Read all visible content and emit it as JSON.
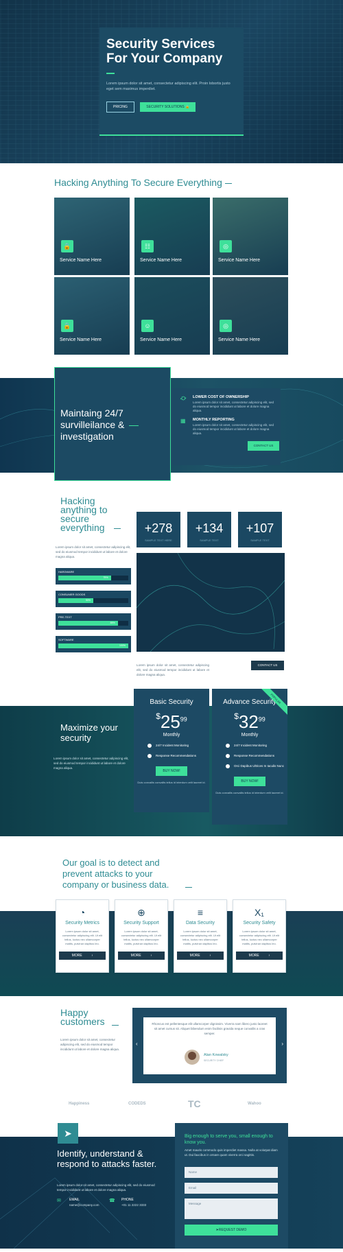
{
  "hero": {
    "title": "Security Services For Your Company",
    "text": "Lorem ipsum dolor sit amet, consectetur adipiscing elit. Proin lobortis justo eget sem maximus imperdiet.",
    "btn1": "PRICING",
    "btn2": "SECURITY SOLUTIONS"
  },
  "services": {
    "title": "Hacking Anything To Secure Everything",
    "items": [
      {
        "label": "Service Name Here",
        "icon": "lock-icon"
      },
      {
        "label": "Service Name Here",
        "icon": "document-icon"
      },
      {
        "label": "Service Name Here",
        "icon": "eye-slash-icon"
      },
      {
        "label": "Service Name Here",
        "icon": "lock-icon"
      },
      {
        "label": "Service Name Here",
        "icon": "smile-icon"
      },
      {
        "label": "Service Name Here",
        "icon": "eye-slash-icon"
      }
    ]
  },
  "surveillance": {
    "title": "Maintaing 24/7 survilleilance & investigation",
    "item1_title": "LOWER COST OF OWNERSHIP",
    "item1_text": "Lorem ipsum dolor sit amet, consectetur adipiscing elit, sed do eiusmod tempor incididunt ut labore et dolore magna aliqua.",
    "item2_title": "MONTHLY REPORTING",
    "item2_text": "Lorem ipsum dolor sit amet, consectetur adipiscing elit, sed do eiusmod tempor incididunt ut labore et dolore magna aliqua.",
    "btn": "CONTACT US"
  },
  "hacking": {
    "title": "Hacking anything to secure everything",
    "text": "Lorem ipsum dolor sit amet, consectetur adipiscing elit, sed do eiusmod tempor incididunt ut labore et dolore magna aliqua.",
    "stats": [
      {
        "value": "+278",
        "label": "SAMPLE TEXT HERE"
      },
      {
        "value": "+134",
        "label": "SAMPLE TEXT"
      },
      {
        "value": "+107",
        "label": "SAMPLE TEXT"
      }
    ],
    "bars": [
      {
        "label": "HARDWARE",
        "pct": "75%",
        "value": 0.75
      },
      {
        "label": "CONSUMER GOODS",
        "pct": "50%",
        "value": 0.5
      },
      {
        "label": "PRE-TEXT",
        "pct": "85%",
        "value": 0.85
      },
      {
        "label": "SOFTWARE",
        "pct": "100%",
        "value": 1.0
      }
    ],
    "text2": "Lorem ipsum dolor sit amet, consectetur adipiscing elit, sed do eiusmod tempor incididunt ut labore et dolore magna aliqua.",
    "btn": "CONTACT US"
  },
  "pricing": {
    "title": "Maximize your security",
    "text": "Lorem ipsum dolor sit amet, consectetur adipiscing elit, sed do eiusmod tempor incididunt ut labore et dolore magna aliqua.",
    "plans": [
      {
        "name": "Basic Security",
        "cur": "$",
        "amount": "25",
        "cents": "99",
        "period": "Monthly",
        "features": [
          "24/7 Incident Monitoring",
          "Response Recommendations"
        ],
        "btn": "BUY NOW!",
        "note": "Duis convallis convallis tellus id interdum velit laoreet id."
      },
      {
        "name": "Advance Security",
        "cur": "$",
        "amount": "32",
        "cents": "99",
        "period": "Monthly",
        "badge": "POPULAR",
        "features": [
          "24/7 Incident Monitoring",
          "Response Recommendations",
          "Orci Dapibus Ultrices In Iaculis Nunc"
        ],
        "btn": "BUY NOW!",
        "note": "Duis convallis convallis tellus id interdum velit laoreet id."
      }
    ]
  },
  "goal": {
    "title": "Our goal is to detect and prevent attacks to your company or business data.",
    "cards": [
      {
        "title": "Security Metrics",
        "icon": "gauge-icon",
        "text": "Lorem ipsum dolor sit amet, consectetur adipiscing elit. Ut elit tellus, luctus nec ullamcorper mattis, pulvinar dapibus leo.",
        "btn": "MORE"
      },
      {
        "title": "Security Support",
        "icon": "lifebuoy-icon",
        "text": "Lorem ipsum dolor sit amet, consectetur adipiscing elit. Ut elit tellus, luctus nec ullamcorper mattis, pulvinar dapibus leo.",
        "btn": "MORE"
      },
      {
        "title": "Data Security",
        "icon": "database-icon",
        "text": "Lorem ipsum dolor sit amet, consectetur adipiscing elit. Ut elit tellus, luctus nec ullamcorper mattis, pulvinar dapibus leo.",
        "btn": "MORE"
      },
      {
        "title": "Security Safety",
        "icon": "subscript-icon",
        "text": "Lorem ipsum dolor sit amet, consectetur adipiscing elit. Ut elit tellus, luctus nec ullamcorper mattis, pulvinar dapibus leo.",
        "btn": "MORE"
      }
    ]
  },
  "testimonials": {
    "title": "Happy customers",
    "text": "Lorem ipsum dolor sit amet, consectetur adipiscing elit, sed do eiusmod tempor incididunt ut labore et dolore magna aliqua.",
    "quote": "Rhoncus est pellentesque elit ullamcorper dignissim. Viverra nam libero justo laoreet sit amet cursus sit. Aliquet bibendum enim facilisis gravida neque convallis a cras semper.",
    "name": "Alan Kowalsky",
    "role": "SECURITY CHIEF"
  },
  "logos": [
    "Happiness",
    "CODEDS",
    "TC",
    "Wahoo"
  ],
  "contact": {
    "title": "Identify, understand & respond to attacks faster.",
    "text": "Lorem ipsum dolor sit amet, consectetur adipiscing elit, sed do eiusmod tempor incididunt ut labore et dolore magna aliqua.",
    "email_label": "EMAIL",
    "email": "name@company.com",
    "phone_label": "PHONE",
    "phone": "+01 11 2222 3333",
    "form_title": "Big enough to serve you, small enough to know you.",
    "form_text": "Amet mauris commodo quis imperdiet massa. Nulla at volutpat diam ut. Dui faucibus in ornare quam viverra orci sagittis.",
    "name_ph": "Name",
    "email_ph": "Email",
    "message_ph": "Message",
    "submit": "REQUEST DEMO"
  },
  "colors": {
    "accent": "#3ee09a",
    "dark": "#1d4a64",
    "teal": "#2f8c93"
  }
}
